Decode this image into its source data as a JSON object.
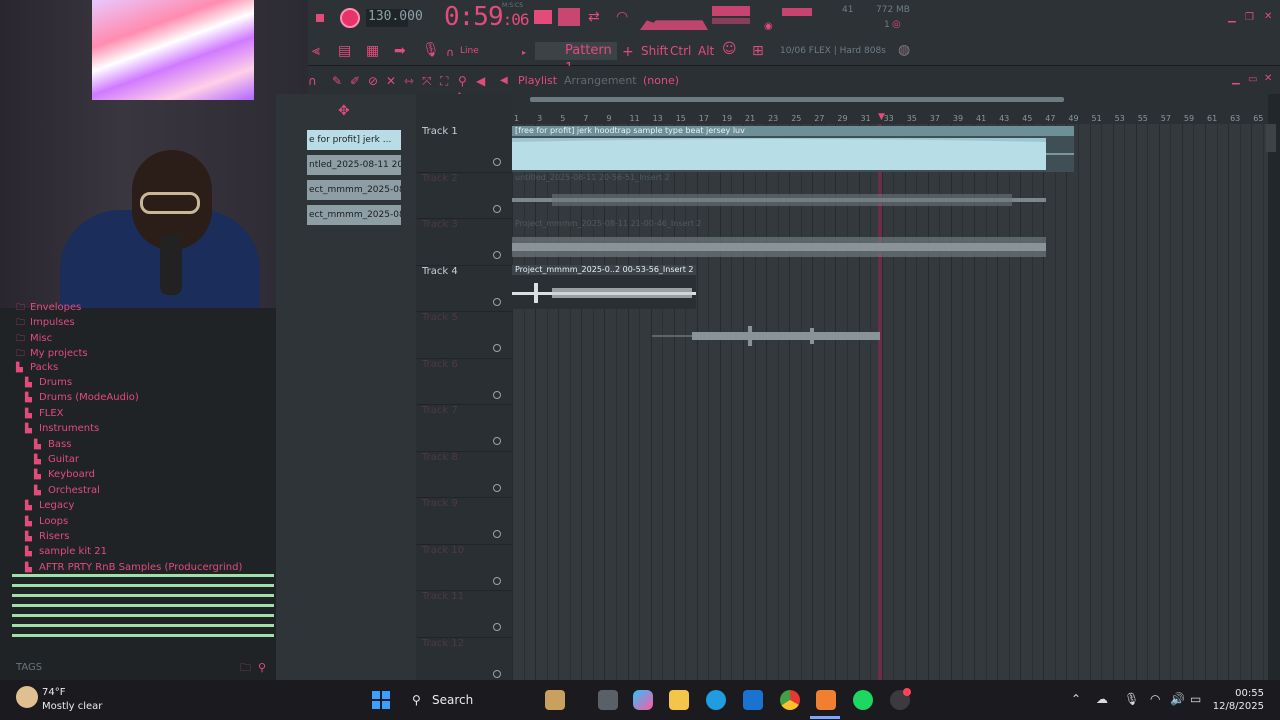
{
  "transport": {
    "tempo": "130.000",
    "time_main": "0:59",
    "time_sub": ":06",
    "time_label": "M:S:CS",
    "cpu_num": "41",
    "memory": "772 MB",
    "mem_sub": "1"
  },
  "toolbar": {
    "snap_label": "Line",
    "pattern_label": "Pattern 1",
    "shift_label": "Shift",
    "ctrl_label": "Ctrl",
    "alt_label": "Alt",
    "hint_text": "10/06  FLEX | Hard 808s"
  },
  "playlist": {
    "title": "Playlist",
    "subtitle": "Arrangement",
    "selection": "(none)"
  },
  "ruler": [
    "1",
    "3",
    "5",
    "7",
    "9",
    "11",
    "13",
    "15",
    "17",
    "19",
    "21",
    "23",
    "25",
    "27",
    "29",
    "31",
    "33",
    "35",
    "37",
    "39",
    "41",
    "43",
    "45",
    "47",
    "49",
    "51",
    "53",
    "55",
    "57",
    "59",
    "61",
    "63",
    "65"
  ],
  "picker_clips": [
    "e for profit] jerk ...",
    "ntled_2025-08-11 20-...",
    "ect_mmmm_2025-08...",
    "ect_mmmm_2025-08..."
  ],
  "tracks": [
    "Track 1",
    "Track 2",
    "Track 3",
    "Track 4",
    "Track 5",
    "Track 6",
    "Track 7",
    "Track 8",
    "Track 9",
    "Track 10",
    "Track 11",
    "Track 12"
  ],
  "clips": [
    "[free for profit] jerk  hoodtrap  sample type beat jersey luv",
    "untitled_2025-08-11 20-56-51_Insert 2",
    "Project_mmmm_2025-08-11 21-00-46_Insert 2",
    "Project_mmmm_2025-0..2 00-53-56_Insert 2"
  ],
  "browser": {
    "items": [
      {
        "label": "Envelopes",
        "indent": 0,
        "type": "folder"
      },
      {
        "label": "Impulses",
        "indent": 0,
        "type": "folder"
      },
      {
        "label": "Misc",
        "indent": 0,
        "type": "folder"
      },
      {
        "label": "My projects",
        "indent": 0,
        "type": "folder"
      },
      {
        "label": "Packs",
        "indent": 0,
        "type": "pack"
      },
      {
        "label": "Drums",
        "indent": 1,
        "type": "pack"
      },
      {
        "label": "Drums (ModeAudio)",
        "indent": 1,
        "type": "pack"
      },
      {
        "label": "FLEX",
        "indent": 1,
        "type": "pack"
      },
      {
        "label": "Instruments",
        "indent": 1,
        "type": "pack"
      },
      {
        "label": "Bass",
        "indent": 2,
        "type": "pack"
      },
      {
        "label": "Guitar",
        "indent": 2,
        "type": "pack"
      },
      {
        "label": "Keyboard",
        "indent": 2,
        "type": "pack"
      },
      {
        "label": "Orchestral",
        "indent": 2,
        "type": "pack"
      },
      {
        "label": "Legacy",
        "indent": 1,
        "type": "pack"
      },
      {
        "label": "Loops",
        "indent": 1,
        "type": "pack"
      },
      {
        "label": "Risers",
        "indent": 1,
        "type": "pack"
      },
      {
        "label": "sample kit 21",
        "indent": 1,
        "type": "pack"
      },
      {
        "label": "AFTR PRTY RnB Samples (Producergrind)",
        "indent": 1,
        "type": "pack"
      }
    ],
    "tags_label": "TAGS"
  },
  "taskbar": {
    "weather_temp": "74°F",
    "weather_desc": "Mostly clear",
    "search_label": "Search",
    "time": "00:55",
    "date": "12/8/2025"
  },
  "colors": {
    "accent": "#e34b7b",
    "clip_main": "#9fc6d0",
    "playhead": "#7a2a48",
    "green_lines": "#9fe0a8"
  }
}
